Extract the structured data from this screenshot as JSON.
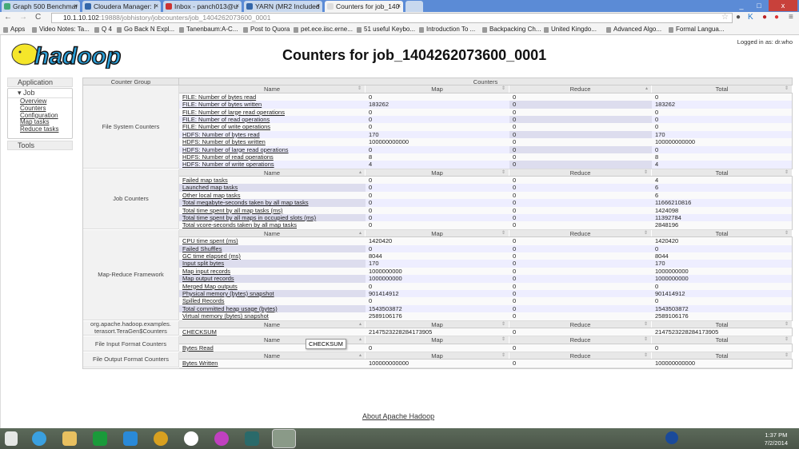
{
  "browser": {
    "tabs": [
      "Graph 500 Benchmar",
      "Cloudera Manager: I",
      "Inbox - panch013@u",
      "YARN (MR2 Included",
      "Counters for job_140"
    ],
    "url_host": "10.1.10.102",
    "url_rest": ":19888/jobhistory/jobcounters/job_1404262073600_0001",
    "bookmarks": [
      "Apps",
      "Video Notes: Ta...",
      "Q 4",
      "Go Back N Expl...",
      "Tanenbaum:A-C...",
      "Post to Quora",
      "pet.ece.iisc.erne...",
      "51 useful Keybo...",
      "Introduction To ...",
      "Backpacking Ch...",
      "United Kingdo...",
      "Advanced Algo...",
      "Formal Langua..."
    ]
  },
  "header": {
    "logo": "hadoop",
    "title": "Counters for job_1404262073600_0001",
    "login": "Logged in as: dr.who"
  },
  "nav": {
    "application": "Application",
    "job": "Job",
    "job_links": [
      "Overview",
      "Counters",
      "Configuration",
      "Map tasks",
      "Reduce tasks"
    ],
    "tools": "Tools"
  },
  "table": {
    "group_header": "Counter Group",
    "counters_header": "Counters",
    "cols": [
      "Name",
      "Map",
      "Reduce",
      "Total"
    ],
    "groups": [
      {
        "name": "File System Counters",
        "rows": [
          [
            "FILE: Number of bytes read",
            "0",
            "0",
            "0"
          ],
          [
            "FILE: Number of bytes written",
            "183262",
            "0",
            "183262"
          ],
          [
            "FILE: Number of large read operations",
            "0",
            "0",
            "0"
          ],
          [
            "FILE: Number of read operations",
            "0",
            "0",
            "0"
          ],
          [
            "FILE: Number of write operations",
            "0",
            "0",
            "0"
          ],
          [
            "HDFS: Number of bytes read",
            "170",
            "0",
            "170"
          ],
          [
            "HDFS: Number of bytes written",
            "100000000000",
            "0",
            "100000000000"
          ],
          [
            "HDFS: Number of large read operations",
            "0",
            "0",
            "0"
          ],
          [
            "HDFS: Number of read operations",
            "8",
            "0",
            "8"
          ],
          [
            "HDFS: Number of write operations",
            "4",
            "0",
            "4"
          ]
        ]
      },
      {
        "name": "Job Counters",
        "rows": [
          [
            "Failed map tasks",
            "0",
            "0",
            "4"
          ],
          [
            "Launched map tasks",
            "0",
            "0",
            "6"
          ],
          [
            "Other local map tasks",
            "0",
            "0",
            "6"
          ],
          [
            "Total megabyte-seconds taken by all map tasks",
            "0",
            "0",
            "11666210816"
          ],
          [
            "Total time spent by all map tasks (ms)",
            "0",
            "0",
            "1424098"
          ],
          [
            "Total time spent by all maps in occupied slots (ms)",
            "0",
            "0",
            "11392784"
          ],
          [
            "Total vcore-seconds taken by all map tasks",
            "0",
            "0",
            "2848196"
          ]
        ]
      },
      {
        "name": "Map-Reduce Framework",
        "rows": [
          [
            "CPU time spent (ms)",
            "1420420",
            "0",
            "1420420"
          ],
          [
            "Failed Shuffles",
            "0",
            "0",
            "0"
          ],
          [
            "GC time elapsed (ms)",
            "8044",
            "0",
            "8044"
          ],
          [
            "Input split bytes",
            "170",
            "0",
            "170"
          ],
          [
            "Map input records",
            "1000000000",
            "0",
            "1000000000"
          ],
          [
            "Map output records",
            "1000000000",
            "0",
            "1000000000"
          ],
          [
            "Merged Map outputs",
            "0",
            "0",
            "0"
          ],
          [
            "Physical memory (bytes) snapshot",
            "901414912",
            "0",
            "901414912"
          ],
          [
            "Spilled Records",
            "0",
            "0",
            "0"
          ],
          [
            "Total committed heap usage (bytes)",
            "1543503872",
            "0",
            "1543503872"
          ],
          [
            "Virtual memory (bytes) snapshot",
            "2589106176",
            "0",
            "2589106176"
          ]
        ]
      },
      {
        "name": "org.apache.hadoop.examples.\nterasort.TeraGen$Counters",
        "rows": [
          [
            "CHECKSUM",
            "2147523228284173905",
            "0",
            "2147523228284173905"
          ]
        ]
      },
      {
        "name": "File Input Format Counters",
        "rows": [
          [
            "Bytes Read",
            "0",
            "0",
            "0"
          ]
        ]
      },
      {
        "name": "File Output Format Counters",
        "rows": [
          [
            "Bytes Written",
            "100000000000",
            "0",
            "100000000000"
          ]
        ]
      }
    ]
  },
  "tooltip": "CHECKSUM",
  "footer": {
    "about": "About Apache Hadoop"
  },
  "taskbar": {
    "time": "1:37 PM",
    "date": "7/2/2014"
  }
}
